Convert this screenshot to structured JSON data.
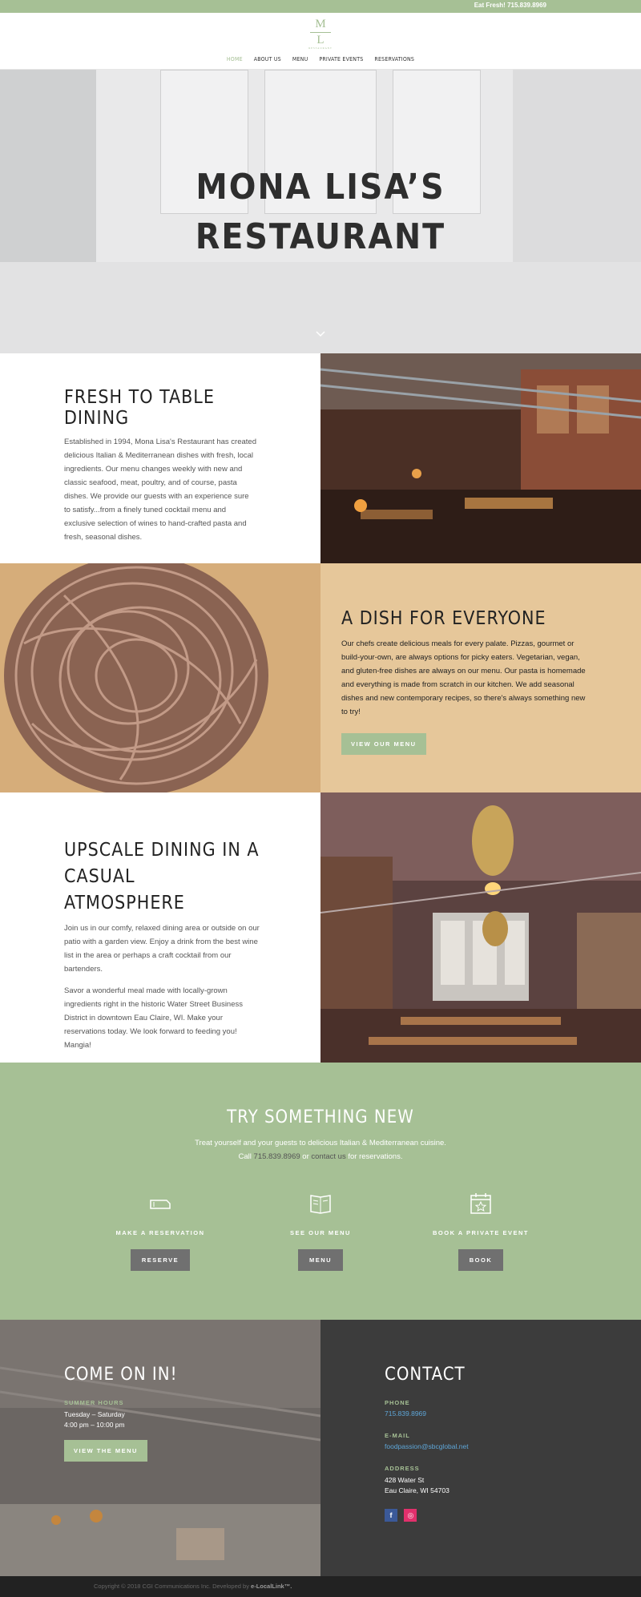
{
  "topbar": {
    "phone": "Eat Fresh! 715.839.8969"
  },
  "logo": {
    "top_letter": "M",
    "bottom_letter": "L",
    "tagline": "RESTAURANT"
  },
  "nav": {
    "items": [
      "HOME",
      "ABOUT US",
      "MENU",
      "PRIVATE EVENTS",
      "RESERVATIONS"
    ],
    "active": "HOME"
  },
  "hero": {
    "title_line1": "MONA LISA’S",
    "title_line2": "RESTAURANT"
  },
  "fresh": {
    "title": "FRESH TO TABLE DINING",
    "body": "Established in 1994, Mona Lisa's Restaurant has created delicious Italian & Mediterranean dishes with fresh, local ingredients. Our menu changes weekly with new and classic seafood, meat, poultry, and of course, pasta dishes. We provide our guests with an experience sure to satisfy...from a finely tuned cocktail menu and exclusive selection of wines to hand-crafted pasta and fresh, seasonal dishes."
  },
  "dish": {
    "title": "A DISH FOR EVERYONE",
    "body": "Our chefs create delicious meals for every palate. Pizzas, gourmet or build-your-own, are always options for picky eaters. Vegetarian, vegan, and gluten-free dishes are always on our menu. Our pasta is homemade and everything is made from scratch in our kitchen. We add seasonal dishes and new contemporary recipes, so there's always something new to try!",
    "button": "VIEW OUR MENU"
  },
  "upscale": {
    "title_line1": "UPSCALE DINING IN A",
    "title_line2": "CASUAL ATMOSPHERE",
    "body1": "Join us in our comfy, relaxed dining area or outside on our patio with a garden view. Enjoy a drink from the best wine list in the area or perhaps a craft cocktail from our bartenders.",
    "body2": "Savor a wonderful meal made with locally-grown ingredients right in the historic Water Street Business District in downtown Eau Claire, WI. Make your reservations today. We look forward to feeding you! Mangia!"
  },
  "cta": {
    "title": "TRY SOMETHING NEW",
    "line1": "Treat yourself and your guests to delicious Italian & Mediterranean cuisine.",
    "line2_pre": "Call",
    "line2_phone": "715.839.8969",
    "line2_mid": "or",
    "line2_contact": "contact us",
    "line2_post": "for reservations.",
    "columns": [
      {
        "icon": "ticket-icon",
        "label": "MAKE A RESERVATION",
        "button": "RESERVE"
      },
      {
        "icon": "menu-book-icon",
        "label": "SEE OUR MENU",
        "button": "MENU"
      },
      {
        "icon": "calendar-star-icon",
        "label": "BOOK A PRIVATE EVENT",
        "button": "BOOK"
      }
    ]
  },
  "footer": {
    "left": {
      "title": "COME ON IN!",
      "hours_label": "SUMMER HOURS",
      "hours_days": "Tuesday – Saturday",
      "hours_time": "4:00 pm – 10:00 pm",
      "button": "VIEW THE MENU"
    },
    "right": {
      "title": "CONTACT",
      "phone_label": "PHONE",
      "phone": "715.839.8969",
      "email_label": "E-MAIL",
      "email": "foodpassion@sbcglobal.net",
      "address_label": "ADDRESS",
      "address_line1": "428 Water St",
      "address_line2": "Eau Claire, WI 54703",
      "social": [
        "f",
        "◎"
      ]
    }
  },
  "copyright": {
    "text": "Copyright © 2018 CGI Communications Inc. Developed by",
    "brand": "e-LocalLink™."
  },
  "colors": {
    "accent": "#a6c095",
    "dark": "#3c3c3c",
    "button_gray": "#707070"
  }
}
